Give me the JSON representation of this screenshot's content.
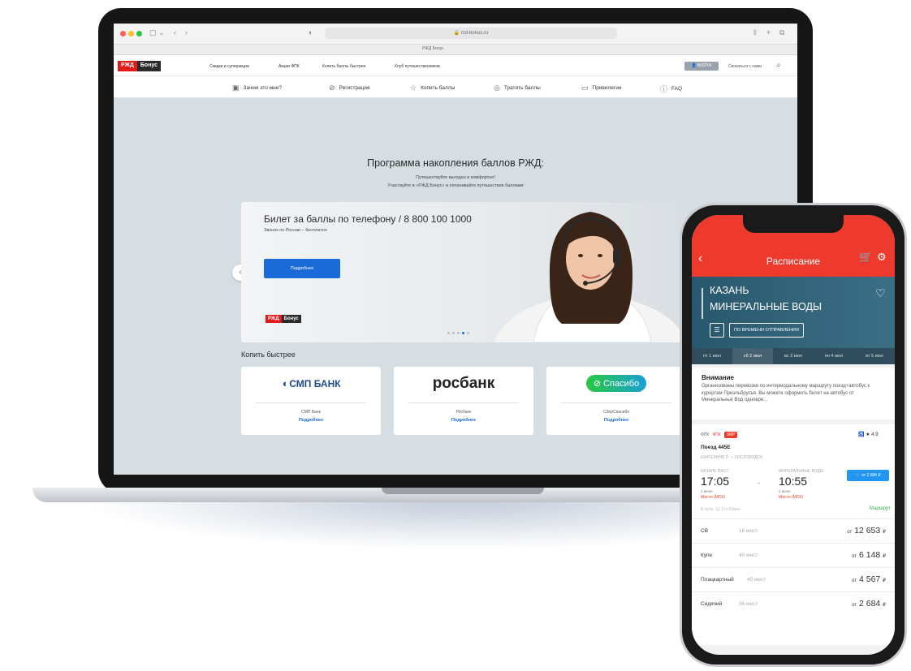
{
  "browser": {
    "url": "rzd-bonus.ru",
    "tab_title": "РЖД Бонус"
  },
  "site": {
    "logo_rzd": "РЖД",
    "logo_bonus": "Бонус",
    "top_links": [
      "Скидки и суперакции",
      "Акции ФПК",
      "Копить баллы быстрее",
      "Клуб путешественников"
    ],
    "login_label": "ВОЙТИ",
    "contact_label": "Связаться с нами",
    "subnav": [
      {
        "label": "Зачем это мне?",
        "icon": "train-icon"
      },
      {
        "label": "Регистрация",
        "icon": "check-circle-icon"
      },
      {
        "label": "Копить баллы",
        "icon": "star-icon"
      },
      {
        "label": "Тратить баллы",
        "icon": "coin-icon"
      },
      {
        "label": "Привилегии",
        "icon": "card-icon"
      },
      {
        "label": "FAQ",
        "icon": "question-icon"
      }
    ],
    "hero": {
      "title": "Программа накопления баллов РЖД:",
      "subtitle_1": "Путешествуйте выгодно и комфортно!",
      "subtitle_2": "Участвуйте в «РЖД Бонус» и оплачивайте путешествия баллами"
    },
    "banner": {
      "title": "Билет за баллы по телефону / 8 800 100 1000",
      "subtitle": "Звонок по России – бесплатно",
      "button": "Подробнее",
      "logo_rzd": "РЖД",
      "logo_bonus": "Бонус"
    },
    "section_title": "Копить быстрее",
    "partners": [
      {
        "logo": "СМП БАНК",
        "name": "СМП Банк",
        "link": "Подробнее"
      },
      {
        "logo": "росбанк",
        "name": "Росбанк",
        "link": "Подробнее"
      },
      {
        "logo": "Спасибо",
        "name": "СберСпасибо",
        "link": "Подробнее"
      }
    ]
  },
  "app": {
    "title": "Расписание",
    "from": "КАЗАНЬ",
    "to": "МИНЕРАЛЬНЫЕ ВОДЫ",
    "sort_label": "ПО ВРЕМЕНИ ОТПРАВЛЕНИЯ",
    "dates": [
      {
        "day": "пт",
        "date": "1 июл"
      },
      {
        "day": "сб",
        "date": "2 июл"
      },
      {
        "day": "вс",
        "date": "3 июл"
      },
      {
        "day": "пн",
        "date": "4 июл"
      },
      {
        "day": "вт",
        "date": "5 июл"
      }
    ],
    "notice": {
      "title": "Внимание",
      "text": "Организованы перевозки по интермодальному маршруту поезд+автобус к курортам Приэльбрусья. Вы можете оформить билет на автобус от Минеральных Вод одноврe..."
    },
    "train": {
      "tag_fpk": "ФПК",
      "tag_brand": "ФПК",
      "tag_badge": "SMP",
      "rating": "★ 4.9",
      "number": "Поезд 445Е",
      "route": "ЕКАТЕРИНБ П — КИСЛОВОДСК",
      "station_from": "КАЗАНЬ ПАСС",
      "station_to": "МИНЕРАЛЬНЫЕ ВОДЫ",
      "dep_time": "17:05",
      "arr_time": "10:55",
      "dep_date": "2 июля",
      "arr_date": "4 июля",
      "dep_tz": "Местн (МСК)",
      "arr_tz": "Местн (МСК)",
      "price_button": "от 2 684 ₽",
      "travel_time": "В пути: 1д 17ч 50мин",
      "route_link": "Маршрут"
    },
    "cars": [
      {
        "type": "СВ",
        "seats": "16 мест",
        "price_prefix": "от",
        "price": "12 653",
        "currency": "₽"
      },
      {
        "type": "Купе",
        "seats": "40 мест",
        "price_prefix": "от",
        "price": "6 148",
        "currency": "₽"
      },
      {
        "type": "Плацкартный",
        "seats": "45 мест",
        "price_prefix": "от",
        "price": "4 567",
        "currency": "₽"
      },
      {
        "type": "Сидячий",
        "seats": "56 мест",
        "price_prefix": "от",
        "price": "2 684",
        "currency": "₽"
      }
    ]
  },
  "colors": {
    "rzd_red": "#e21a1a",
    "app_red": "#ee3a2c",
    "link_blue": "#1a6bd8",
    "route_green": "#2eaa47"
  }
}
